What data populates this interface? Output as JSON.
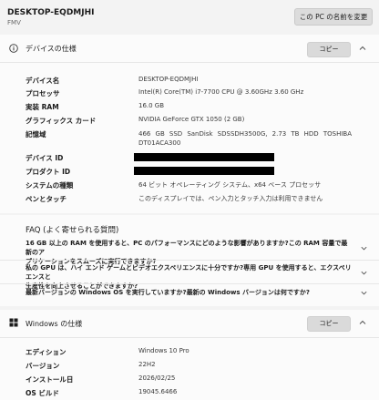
{
  "header": {
    "device_name": "DESKTOP-EQDMJHI",
    "model": "FMV",
    "rename_button": "この PC の名前を変更"
  },
  "device_spec": {
    "title": "デバイスの仕様",
    "copy_label": "コピー",
    "rows": [
      {
        "label": "デバイス名",
        "value": "DESKTOP-EQDMJHI"
      },
      {
        "label": "プロセッサ",
        "value": "Intel(R) Core(TM) i7-7700 CPU @ 3.60GHz   3.60 GHz"
      },
      {
        "label": "実装 RAM",
        "value": "16.0 GB"
      },
      {
        "label": "グラフィックス カード",
        "value": "NVIDIA GeForce GTX 1050 (2 GB)"
      },
      {
        "label": "記憶域",
        "value": "466 GB SSD SanDisk SDSSDH3500G, 2.73 TB HDD TOSHIBA",
        "value2": "DT01ACA300"
      },
      {
        "label": "デバイス ID",
        "value": ""
      },
      {
        "label": "プロダクト ID",
        "value": ""
      },
      {
        "label": "システムの種類",
        "value": "64 ビット オペレーティング システム、x64 ベース プロセッサ"
      },
      {
        "label": "ペンとタッチ",
        "value": "このディスプレイでは、ペン入力とタッチ入力は利用できません"
      }
    ]
  },
  "faq": {
    "title": "FAQ (よく寄せられる質問)",
    "items": [
      {
        "line1": "16 GB 以上の RAM を使用すると、PC のパフォーマンスにどのような影響がありますか?この RAM 容量で最新のア",
        "line2": "プリケーションをスムーズに実行できますか?"
      },
      {
        "line1": "私の GPU は、ハイ エンド ゲームとビデオエクスペリエンスに十分ですか?専用 GPU を使用すると、エクスペリエンスと",
        "line2": "生産性を向上させることができますか?"
      },
      {
        "line1": "最新バージョンの Windows OS を実行していますか?最新の Windows バージョンは何ですか?",
        "line2": ""
      }
    ]
  },
  "windows_spec": {
    "title": "Windows の仕様",
    "copy_label": "コピー",
    "rows": [
      {
        "label": "エディション",
        "value": "Windows 10 Pro"
      },
      {
        "label": "バージョン",
        "value": "22H2"
      },
      {
        "label": "インストール日",
        "value": "2026/02/25"
      },
      {
        "label": "OS ビルド",
        "value": "19045.6466"
      }
    ]
  }
}
